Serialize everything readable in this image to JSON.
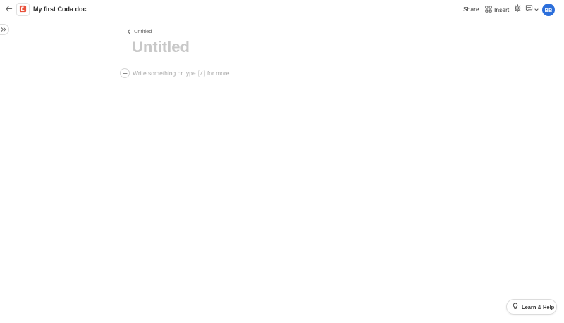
{
  "window": {
    "doc_title": "My first Coda doc"
  },
  "toolbar": {
    "share_label": "Share",
    "insert_label": "Insert",
    "avatar_initials": "BB",
    "avatar_color": "#2c6fdb"
  },
  "icons": {
    "back": "arrow-left-icon",
    "doc": "coda-doc-icon",
    "insert": "grid-icon",
    "settings": "gear-icon",
    "comments": "comment-icon",
    "sidebar": "double-chevron-right-icon",
    "add": "plus-icon",
    "help": "lightbulb-icon"
  },
  "page": {
    "breadcrumb_label": "Untitled",
    "title": "Untitled",
    "placeholder_before": "Write something or type",
    "placeholder_key": "/",
    "placeholder_after": "for more"
  },
  "help": {
    "label": "Learn & Help"
  },
  "colors": {
    "accent": "#2c6fdb",
    "doc_icon": "#e8503a",
    "title_placeholder": "#c8c8c8"
  }
}
